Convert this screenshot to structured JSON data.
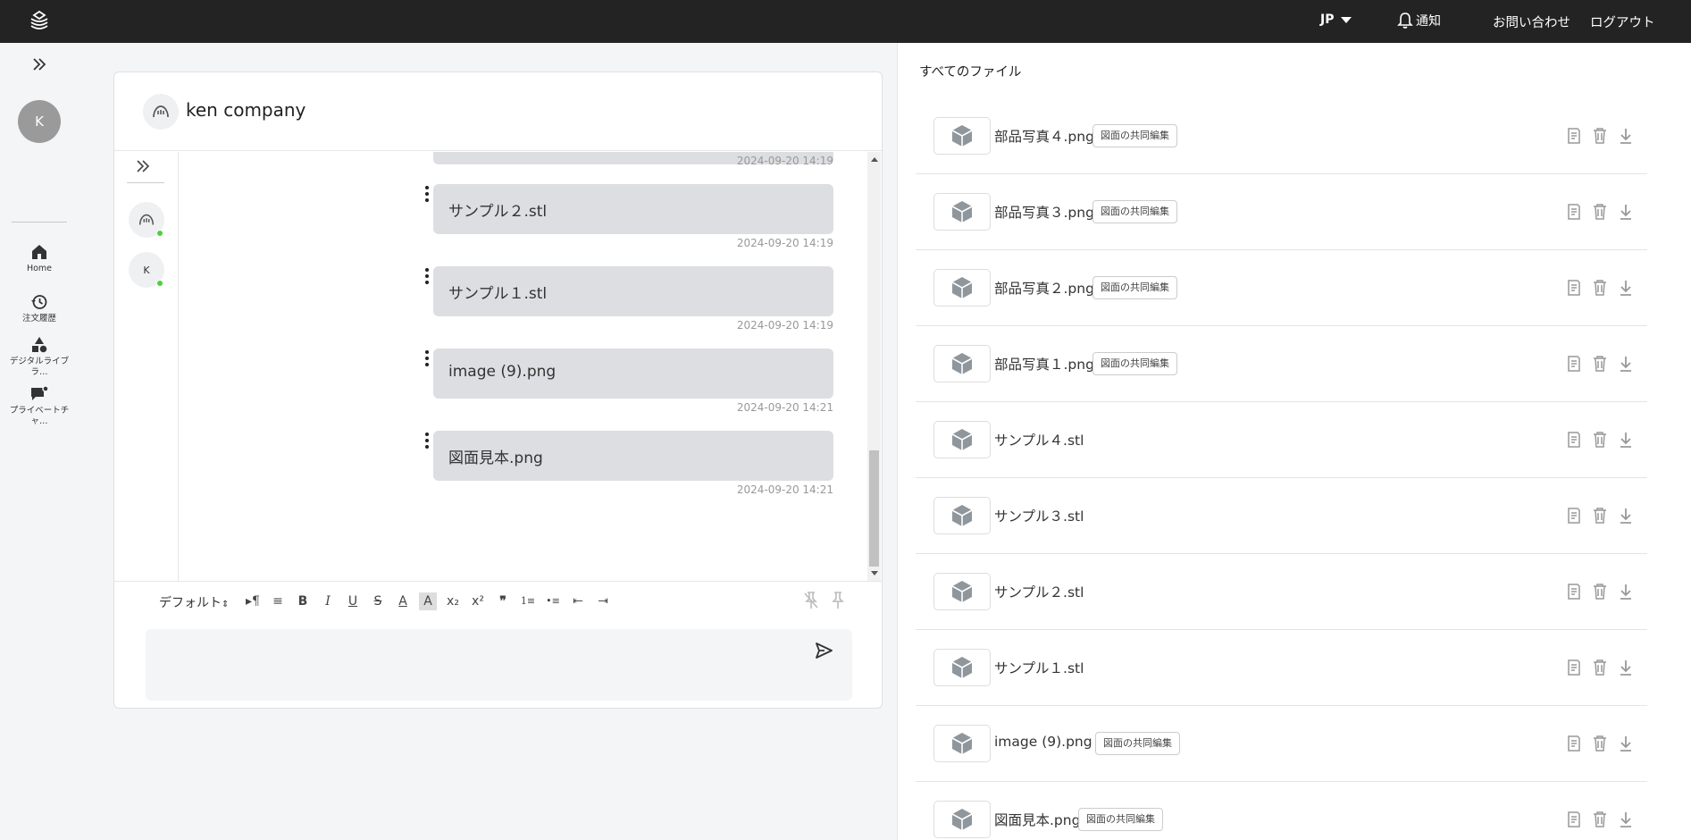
{
  "topbar": {
    "language": "JP",
    "notifications": "通知",
    "contact": "お問い合わせ",
    "logout": "ログアウト"
  },
  "user": {
    "initial": "K"
  },
  "nav": [
    {
      "label": "Home",
      "icon": "home-icon"
    },
    {
      "label": "注文履歴",
      "icon": "history-icon"
    },
    {
      "label": "デジタルライブラ…",
      "icon": "shapes-icon"
    },
    {
      "label": "プライベートチャ…",
      "icon": "private-chat-icon"
    }
  ],
  "chat": {
    "room_title": "ken company",
    "members": [
      {
        "kind": "company"
      },
      {
        "initial": "K"
      }
    ],
    "messages": [
      {
        "text": "",
        "time": "2024-09-20 14:19"
      },
      {
        "text": "サンプル２.stl",
        "time": "2024-09-20 14:19"
      },
      {
        "text": "サンプル１.stl",
        "time": "2024-09-20 14:19"
      },
      {
        "text": "image (9).png",
        "time": "2024-09-20 14:21"
      },
      {
        "text": "図面見本.png",
        "time": "2024-09-20 14:21"
      }
    ],
    "toolbar": {
      "font": "デフォルト",
      "buttons": [
        "▸¶",
        "≡",
        "B",
        "I",
        "U",
        "S",
        "A",
        "A",
        "x₂",
        "x²",
        "❞",
        "1≡",
        "•≡",
        "⇤",
        "⇥"
      ]
    }
  },
  "files": {
    "title": "すべてのファイル",
    "tag_label": "図面の共同編集",
    "items": [
      {
        "name": "部品写真４.png",
        "tag": "図面の共同編集"
      },
      {
        "name": "部品写真３.png",
        "tag": "図面の共同編集"
      },
      {
        "name": "部品写真２.png",
        "tag": "図面の共同編集"
      },
      {
        "name": "部品写真１.png",
        "tag": "図面の共同編集"
      },
      {
        "name": "サンプル４.stl",
        "tag": ""
      },
      {
        "name": "サンプル３.stl",
        "tag": ""
      },
      {
        "name": "サンプル２.stl",
        "tag": ""
      },
      {
        "name": "サンプル１.stl",
        "tag": ""
      },
      {
        "name": "image (9).png",
        "tag": "図面の共同編集"
      },
      {
        "name": "図面見本.png",
        "tag": "図面の共同編集"
      }
    ]
  },
  "colors": {
    "topbar": "#232323",
    "bubble": "#dcdee1",
    "online": "#4cd137"
  }
}
